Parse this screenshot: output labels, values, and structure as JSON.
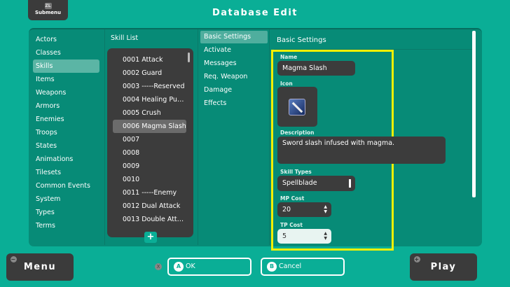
{
  "header": {
    "submenu_key": "ZL",
    "submenu_label": "Submenu",
    "title": "Database Edit"
  },
  "categories": [
    "Actors",
    "Classes",
    "Skills",
    "Items",
    "Weapons",
    "Armors",
    "Enemies",
    "Troops",
    "States",
    "Animations",
    "Tilesets",
    "Common Events",
    "System",
    "Types",
    "Terms"
  ],
  "skill_list": {
    "title": "Skill List",
    "items": [
      "0001 Attack",
      "0002 Guard",
      "0003 -----Reserved",
      "0004 Healing Pu…",
      "0005 Crush",
      "0006 Magma Slash",
      "0007",
      "0008",
      "0009",
      "0010",
      "0011 -----Enemy",
      "0012 Dual Attack",
      "0013 Double Att…"
    ],
    "add_label": "+"
  },
  "tabs": [
    "Basic Settings",
    "Activate",
    "Messages",
    "Req. Weapon",
    "Damage",
    "Effects"
  ],
  "basic": {
    "heading": "Basic Settings",
    "name_label": "Name",
    "name": "Magma Slash",
    "icon_label": "Icon",
    "icon": "sword-icon",
    "desc_label": "Description",
    "description": "Sword slash infused with magma.",
    "skill_type_label": "Skill Types",
    "skill_type": "Spellblade",
    "mp_label": "MP Cost",
    "mp": "20",
    "tp_label": "TP Cost",
    "tp": "5"
  },
  "footer": {
    "menu_mark": "−",
    "menu": "Menu",
    "x_mark": "X",
    "ok_key": "A",
    "ok": "OK",
    "cancel_key": "B",
    "cancel": "Cancel",
    "play_mark": "+",
    "play": "Play"
  },
  "colors": {
    "bg": "#0aae96",
    "panel": "#078b77",
    "highlight": "#f4f000"
  }
}
